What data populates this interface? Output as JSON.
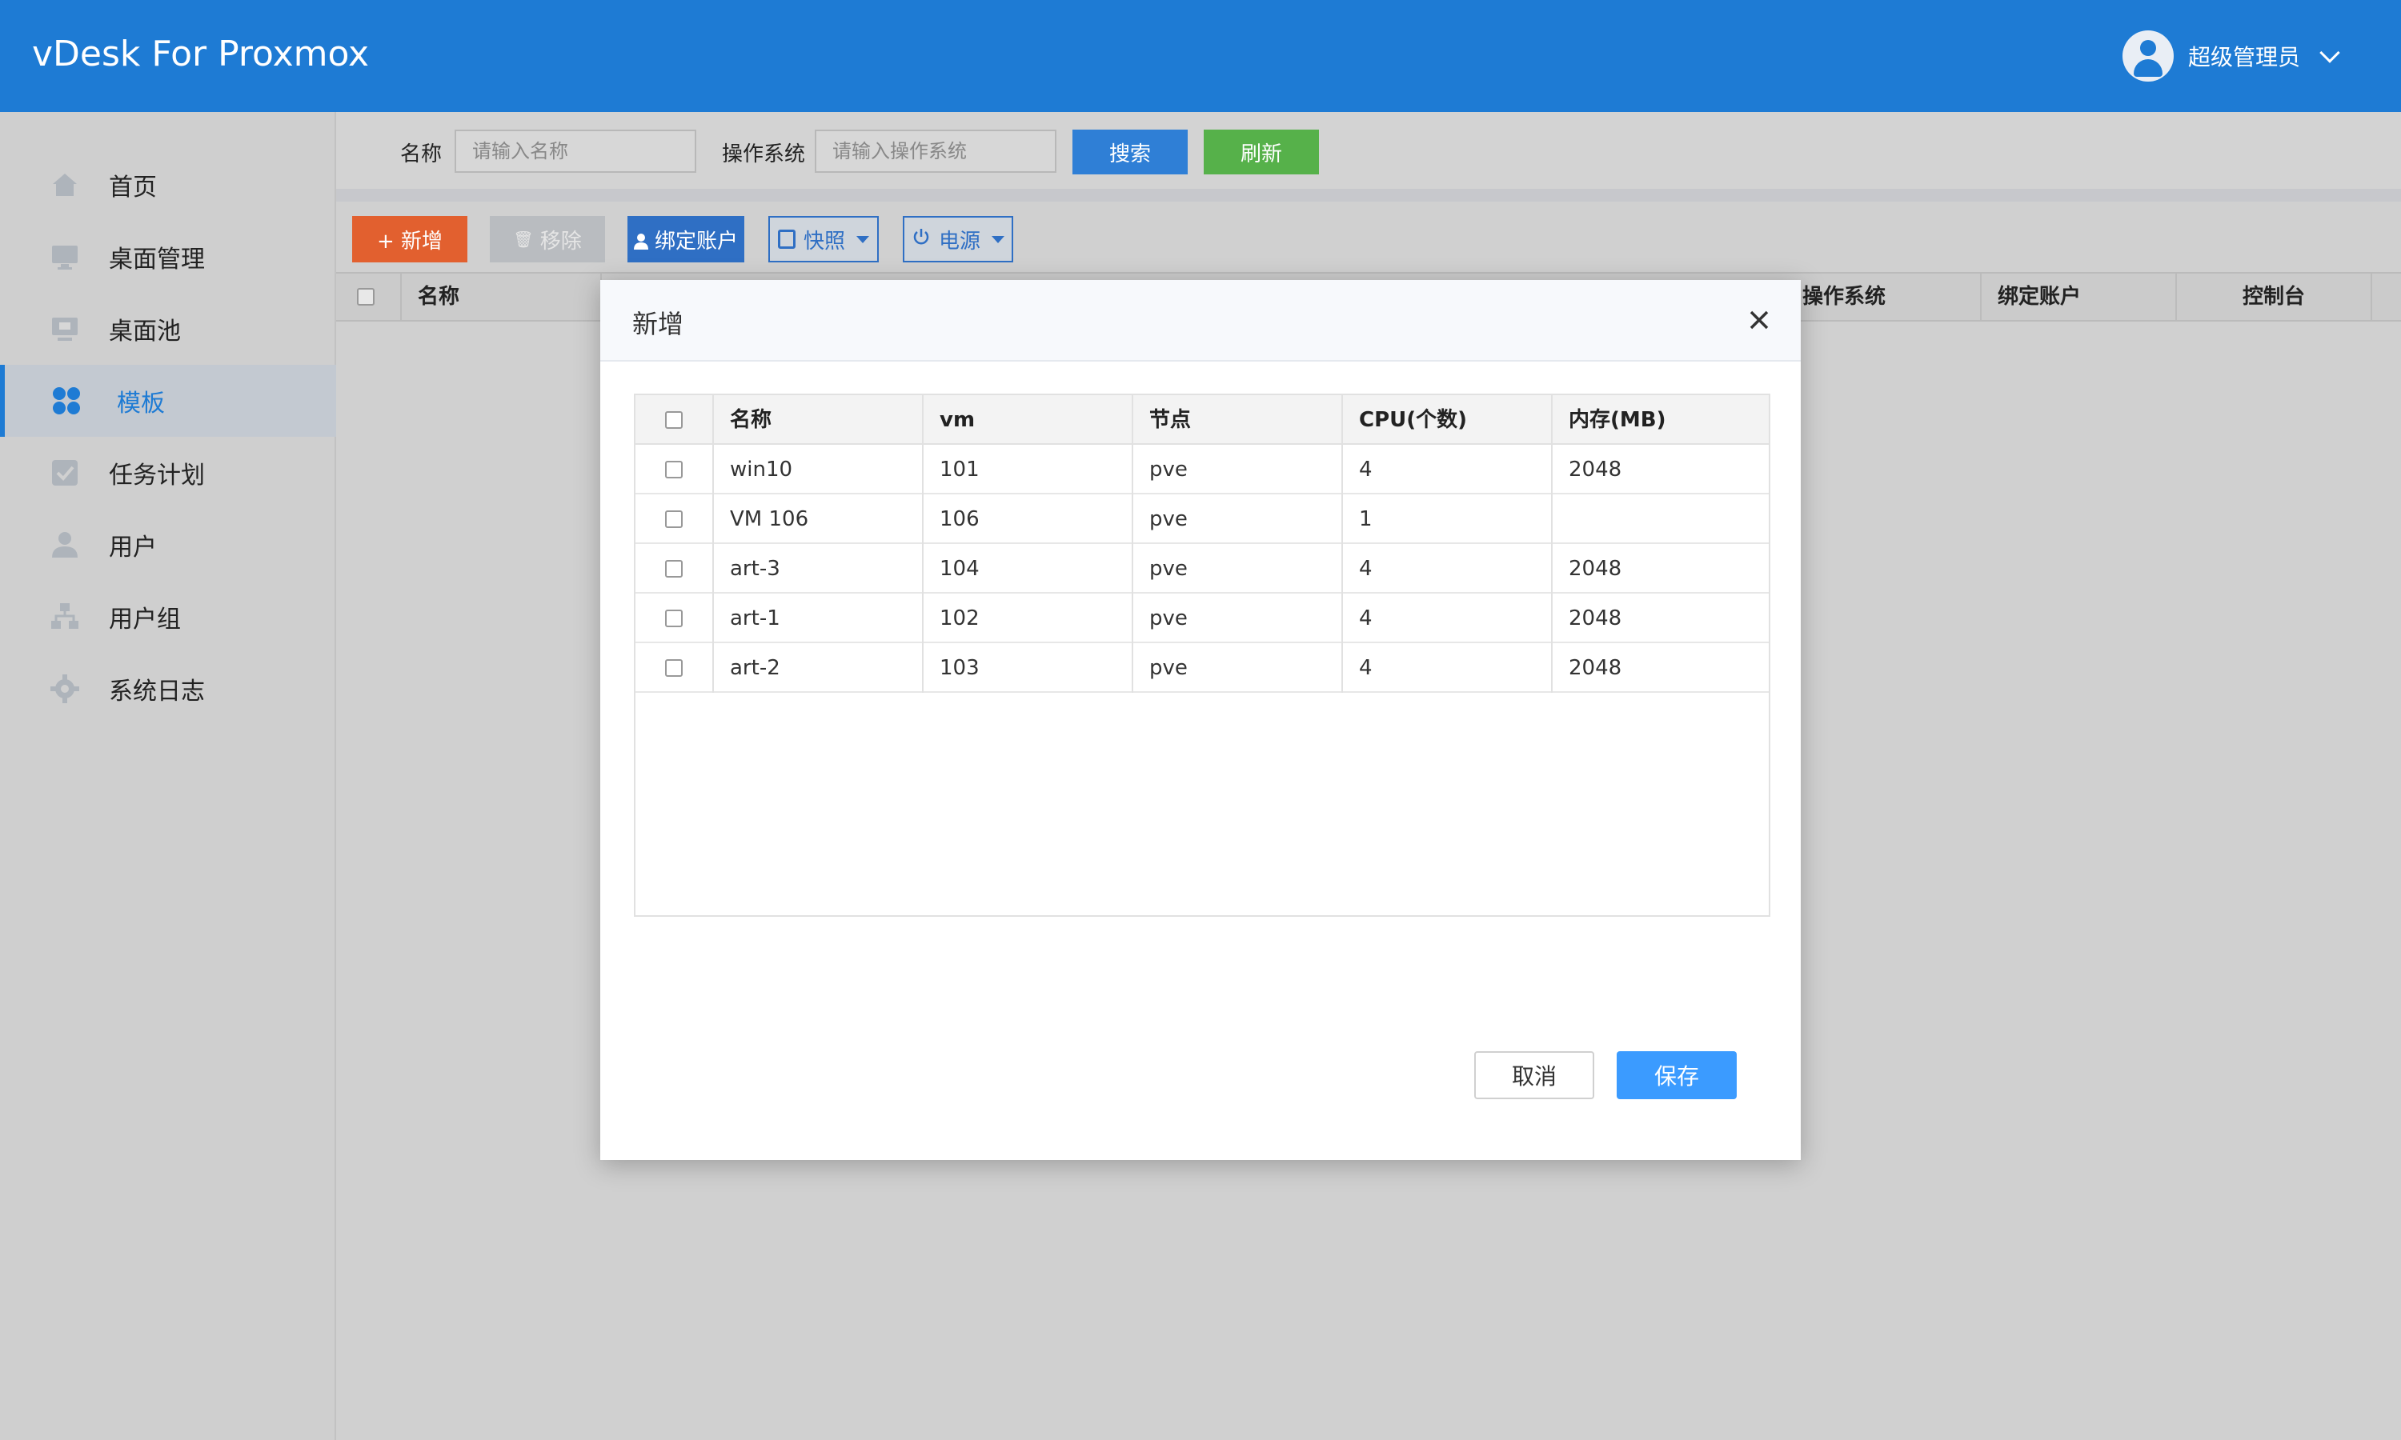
{
  "header": {
    "app_title": "vDesk For Proxmox",
    "user_name": "超级管理员"
  },
  "sidebar": {
    "items": [
      {
        "label": "首页",
        "icon": "home-icon"
      },
      {
        "label": "桌面管理",
        "icon": "monitor-icon"
      },
      {
        "label": "桌面池",
        "icon": "desktop-pool-icon"
      },
      {
        "label": "模板",
        "icon": "template-icon",
        "active": true
      },
      {
        "label": "任务计划",
        "icon": "task-icon"
      },
      {
        "label": "用户",
        "icon": "user-icon"
      },
      {
        "label": "用户组",
        "icon": "user-group-icon"
      },
      {
        "label": "系统日志",
        "icon": "gear-icon"
      }
    ]
  },
  "search": {
    "name_label": "名称",
    "name_placeholder": "请输入名称",
    "os_label": "操作系统",
    "os_placeholder": "请输入操作系统",
    "search_button": "搜索",
    "refresh_button": "刷新"
  },
  "toolbar": {
    "add_button": "+ 新增",
    "remove_button": "移除",
    "bind_button": "绑定账户",
    "snapshot_button": "快照",
    "power_button": "电源"
  },
  "main_table": {
    "headers": {
      "name": "名称",
      "os": "操作系统",
      "bound_account": "绑定账户",
      "console": "控制台"
    }
  },
  "modal": {
    "title": "新增",
    "columns": [
      "名称",
      "vm",
      "节点",
      "CPU(个数)",
      "内存(MB)"
    ],
    "rows": [
      {
        "name": "win10",
        "vm": "101",
        "node": "pve",
        "cpu": "4",
        "memory": "2048"
      },
      {
        "name": "VM 106",
        "vm": "106",
        "node": "pve",
        "cpu": "1",
        "memory": ""
      },
      {
        "name": "art-3",
        "vm": "104",
        "node": "pve",
        "cpu": "4",
        "memory": "2048"
      },
      {
        "name": "art-1",
        "vm": "102",
        "node": "pve",
        "cpu": "4",
        "memory": "2048"
      },
      {
        "name": "art-2",
        "vm": "103",
        "node": "pve",
        "cpu": "4",
        "memory": "2048"
      }
    ],
    "cancel_button": "取消",
    "save_button": "保存"
  },
  "colors": {
    "header": "#1e7bd4",
    "search_button": "#2f7fd6",
    "refresh_button": "#56b14a",
    "add_button": "#e2602f",
    "save_button": "#3b9bff"
  }
}
